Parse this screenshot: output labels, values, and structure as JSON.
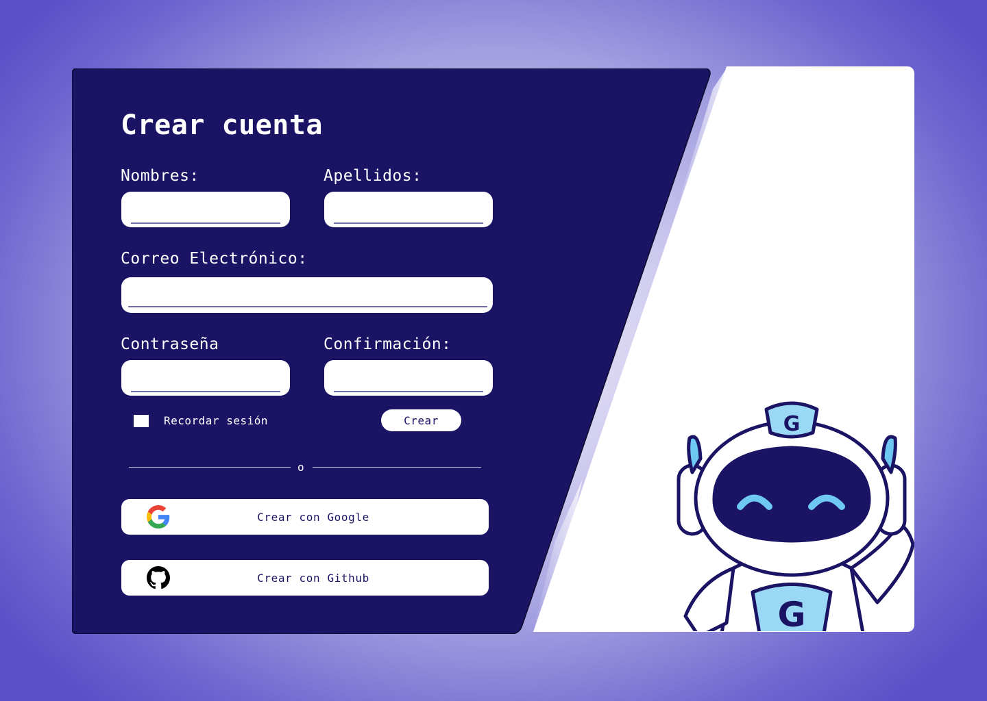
{
  "form": {
    "title": "Crear cuenta",
    "first_name_label": "Nombres:",
    "last_name_label": "Apellidos:",
    "email_label": "Correo Electrónico:",
    "password_label": "Contraseña",
    "confirm_label": "Confirmación:",
    "first_name_value": "",
    "last_name_value": "",
    "email_value": "",
    "password_value": "",
    "confirm_value": "",
    "remember_label": "Recordar sesión",
    "remember_checked": false,
    "create_label": "Crear",
    "divider_text": "o",
    "google_label": "Crear con Google",
    "github_label": "Crear con Github"
  },
  "colors": {
    "panel": "#1b1464",
    "accent": "#6fc8f2",
    "field_underline": "#6d6fa6"
  },
  "icons": {
    "google": "google-icon",
    "github": "github-icon",
    "mascot": "robot-mascot"
  }
}
